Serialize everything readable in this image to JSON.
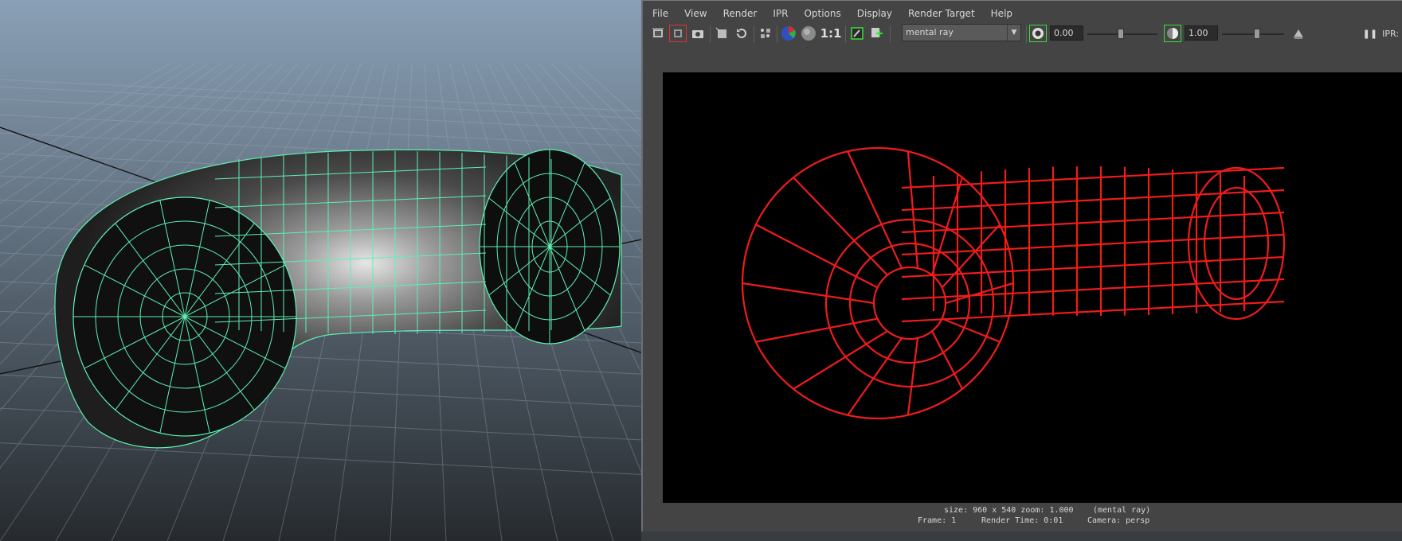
{
  "render_view": {
    "menu": [
      "File",
      "View",
      "Render",
      "IPR",
      "Options",
      "Display",
      "Render Target",
      "Help"
    ],
    "toolbar": {
      "icons": [
        "redo-render-icon",
        "render-region-icon",
        "snapshot-icon",
        "ipr-render-icon",
        "refresh-icon",
        "render-settings-icon",
        "rgb-channels-icon",
        "alpha-channel-icon",
        "real-size-icon",
        "keep-image-icon",
        "remove-image-icon"
      ],
      "real_size_label": "1:1",
      "renderer": "mental ray",
      "exposure": "0.00",
      "gamma": "1.00",
      "ipr_label": "IPR:"
    },
    "status": {
      "size_line": "size: 960 x 540 zoom: 1.000",
      "renderer_line": "(mental ray)",
      "frame": "Frame: 1",
      "render_time": "Render Time: 0:01",
      "camera": "Camera: persp"
    }
  },
  "colors": {
    "wire_viewport": "#5df0b4",
    "wire_render": "#ee1c1c",
    "highlight_frame": "#36e036"
  }
}
